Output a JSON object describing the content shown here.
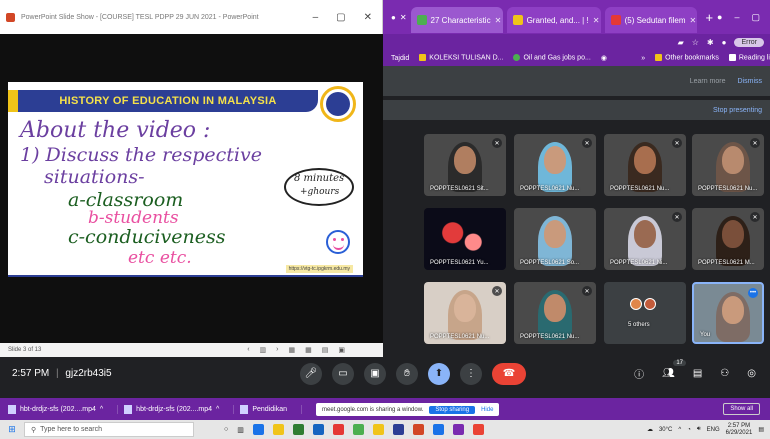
{
  "powerpoint": {
    "title": "PowerPoint Slide Show - [COURSE] TESL PDPP 29 JUN 2021 - PowerPoint",
    "status_text": "Slide 3 of 13",
    "slide": {
      "banner": "HISTORY OF EDUCATION IN MALAYSIA",
      "line1": "About the video :",
      "line2": "1) Discuss the respective",
      "line3": "situations-",
      "item_a": "a-classroom",
      "item_b": "b-students",
      "item_c": "c-conduciveness",
      "etc": "etc etc.",
      "time_note1": "8 minutes",
      "time_note2": "+ghours",
      "url": "https://vtg-tc.ipgkrm.edu.my"
    }
  },
  "browser": {
    "tabs": [
      {
        "label": "27 Characteristic",
        "color": "#4caf50"
      },
      {
        "label": "Granted, and... | !",
        "color": "#f0c419"
      },
      {
        "label": "(5) Sedutan filem",
        "color": "#e53935"
      }
    ],
    "profile_label": "Error",
    "bookmarks": [
      {
        "label": "Tajdid",
        "color": "#f0c419"
      },
      {
        "label": "KOLEKSI TULISAN D...",
        "color": "#f0c419"
      },
      {
        "label": "Oil and Gas jobs po...",
        "color": "#4caf50"
      },
      {
        "label": "Other bookmarks",
        "color": "#f0c419"
      },
      {
        "label": "Reading li",
        "color": "#ffffff"
      }
    ]
  },
  "meet": {
    "learn_more": "Learn more",
    "dismiss": "Dismiss",
    "stop_presenting": "Stop presenting",
    "participants": [
      {
        "label": "POPPTESL0621 Sit...",
        "kind": "face",
        "hijab": "#2b2b2b"
      },
      {
        "label": "POPPTESL0621 Nu...",
        "kind": "face",
        "hijab": "#6fb7d9"
      },
      {
        "label": "POPPTESL0621 Nu...",
        "kind": "face",
        "hijab": "#3a2a20"
      },
      {
        "label": "POPPTESL0621 Nu...",
        "kind": "face",
        "hijab": "#6d5548"
      },
      {
        "label": "POPPTESL0621 Yu...",
        "kind": "fireworks",
        "hijab": ""
      },
      {
        "label": "POPPTESL0621 So...",
        "kind": "face",
        "hijab": "#7fb6d6"
      },
      {
        "label": "POPPTESL0621 Ni...",
        "kind": "face",
        "hijab": "#c9c9d6"
      },
      {
        "label": "POPPTESL0621 M...",
        "kind": "face",
        "hijab": "#2d2018"
      },
      {
        "label": "POPPTESL0621 Nu...",
        "kind": "face",
        "hijab": "#c7a58a"
      },
      {
        "label": "POPPTESL0621 Nu...",
        "kind": "face",
        "hijab": "#2a6a70"
      },
      {
        "label": "5 others",
        "kind": "others",
        "hijab": ""
      },
      {
        "label": "You",
        "kind": "self",
        "hijab": "#7e6c65"
      }
    ],
    "time": "2:57 PM",
    "separator": "|",
    "meeting_code": "gjz2rb43i5",
    "participant_badge": "17"
  },
  "downloads": {
    "items": [
      "hbt-drdjz-sfs (202....mp4",
      "hbt-drdjz-sfs (202....mp4",
      "Pendidikan"
    ],
    "share_note": "meet.google.com is sharing a window.",
    "stop_sharing": "Stop sharing",
    "hide": "Hide",
    "show_all": "Show all"
  },
  "taskbar": {
    "search_placeholder": "Type here to search",
    "temperature": "30°C",
    "language": "ENG",
    "clock_time": "2:57 PM",
    "clock_date": "6/29/2021",
    "apps": [
      "#1a73e8",
      "#f0c419",
      "#2f7d32",
      "#1565c0",
      "#e53935",
      "#4caf50",
      "#f0c419",
      "#2c3e94",
      "#d24726",
      "#1a73e8",
      "#7a2bb0",
      "#ea4335"
    ]
  }
}
